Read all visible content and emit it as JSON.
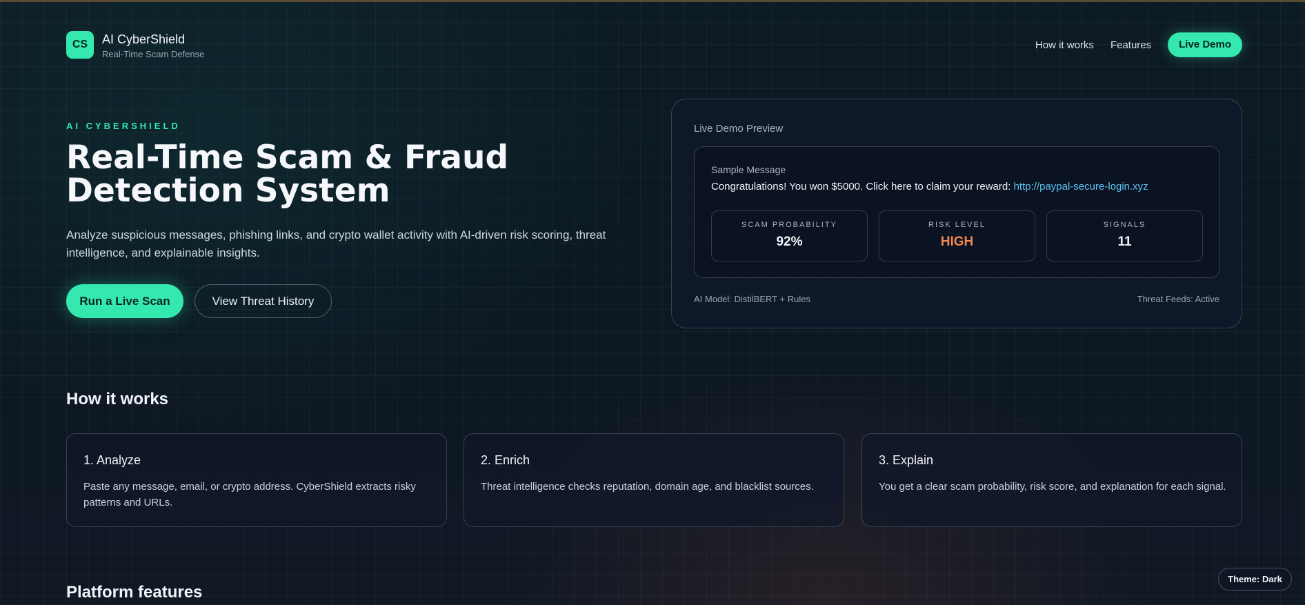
{
  "header": {
    "logo_text": "CS",
    "brand_name": "AI CyberShield",
    "brand_sub": "Real-Time Scam Defense",
    "nav": [
      "How it works",
      "Features"
    ],
    "cta": "Live Demo"
  },
  "hero": {
    "eyebrow": "AI CYBERSHIELD",
    "title": "Real-Time Scam & Fraud Detection System",
    "description": "Analyze suspicious messages, phishing links, and crypto wallet activity with AI-driven risk scoring, threat intelligence, and explainable insights.",
    "primary_button": "Run a Live Scan",
    "secondary_button": "View Threat History"
  },
  "demo": {
    "title": "Live Demo Preview",
    "sample_label": "Sample Message",
    "sample_text": "Congratulations! You won $5000. Click here to claim your reward: ",
    "sample_link": "http://paypal-secure-login.xyz",
    "stats": [
      {
        "label": "SCAM PROBABILITY",
        "value": "92%"
      },
      {
        "label": "RISK LEVEL",
        "value": "HIGH"
      },
      {
        "label": "SIGNALS",
        "value": "11"
      }
    ],
    "footer_left": "AI Model: DistilBERT + Rules",
    "footer_right": "Threat Feeds: Active"
  },
  "how_it_works": {
    "title": "How it works",
    "steps": [
      {
        "title": "1. Analyze",
        "desc": "Paste any message, email, or crypto address. CyberShield extracts risky patterns and URLs."
      },
      {
        "title": "2. Enrich",
        "desc": "Threat intelligence checks reputation, domain age, and blacklist sources."
      },
      {
        "title": "3. Explain",
        "desc": "You get a clear scam probability, risk score, and explanation for each signal."
      }
    ]
  },
  "features": {
    "title": "Platform features"
  },
  "theme_badge": "Theme: Dark",
  "colors": {
    "accent": "#34e8b0",
    "high_risk": "#f0884f",
    "link": "#5cc6f0"
  }
}
